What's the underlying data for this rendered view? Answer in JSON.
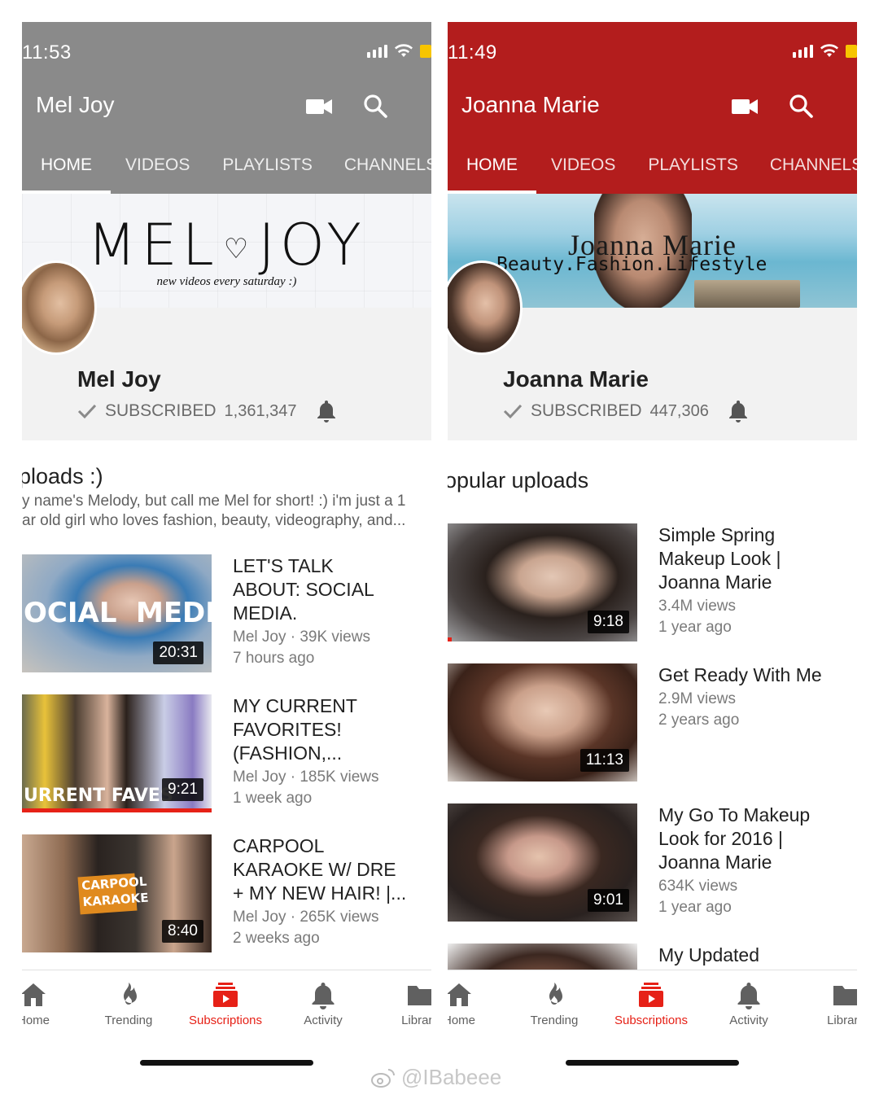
{
  "watermark": {
    "text": "@IBabeee",
    "icon": "weibo-icon"
  },
  "colors": {
    "left_header": "#8a8a8a",
    "right_header": "#b31d1d",
    "accent_red": "#e62117"
  },
  "left": {
    "status": {
      "time": "11:53"
    },
    "channel_title": "Mel Joy",
    "tabs": [
      "HOME",
      "VIDEOS",
      "PLAYLISTS",
      "CHANNELS"
    ],
    "banner": {
      "logo_left": "MEL",
      "logo_right": "JOY",
      "tagline": "new videos every saturday :)"
    },
    "channel": {
      "name": "Mel Joy",
      "subscribed_label": "SUBSCRIBED",
      "subscriber_count": "1,361,347"
    },
    "section_title": "ploads :)",
    "description": [
      "y name's Melody, but call me Mel for short! :) i'm just a 1",
      "ar old girl who loves fashion, beauty, videography, and..."
    ],
    "videos": [
      {
        "title_lines": [
          "LET'S TALK",
          "ABOUT: SOCIAL",
          "MEDIA."
        ],
        "meta1": "Mel Joy · 39K views",
        "meta2": "7 hours ago",
        "duration": "20:31",
        "thumb_text_1": "OCIAL",
        "thumb_text_2": "MEDIA.",
        "progress": 0
      },
      {
        "title_lines": [
          "MY CURRENT",
          "FAVORITES!",
          "(FASHION,..."
        ],
        "meta1": "Mel Joy · 185K views",
        "meta2": "1 week ago",
        "duration": "9:21",
        "thumb_text_1": "URRENT FAVES",
        "progress": 1.0
      },
      {
        "title_lines": [
          "CARPOOL",
          "KARAOKE W/ DRE",
          "+ MY NEW HAIR! |..."
        ],
        "meta1": "Mel Joy · 265K views",
        "meta2": "2 weeks ago",
        "duration": "8:40",
        "thumb_text_1": "CARPOOL",
        "thumb_text_2": "KARAOKE",
        "progress": 0
      }
    ],
    "nav": [
      {
        "label": "Home",
        "icon": "home-icon"
      },
      {
        "label": "Trending",
        "icon": "trending-flame-icon"
      },
      {
        "label": "Subscriptions",
        "icon": "subscriptions-icon",
        "active": true
      },
      {
        "label": "Activity",
        "icon": "bell-icon"
      },
      {
        "label": "Library",
        "icon": "folder-icon"
      }
    ]
  },
  "right": {
    "status": {
      "time": "11:49"
    },
    "channel_title": "Joanna Marie",
    "tabs": [
      "HOME",
      "VIDEOS",
      "PLAYLISTS",
      "CHANNELS"
    ],
    "banner": {
      "title": "Joanna Marie",
      "tagline": "Beauty.Fashion.Lifestyle"
    },
    "channel": {
      "name": "Joanna Marie",
      "subscribed_label": "SUBSCRIBED",
      "subscriber_count": "447,306"
    },
    "section_title": "opular uploads",
    "videos": [
      {
        "title_lines": [
          "Simple Spring",
          "Makeup Look |",
          "Joanna Marie"
        ],
        "meta1": "3.4M views",
        "meta2": "1 year ago",
        "duration": "9:18",
        "progress": 0.02
      },
      {
        "title_lines": [
          "Get Ready With Me"
        ],
        "meta1": "2.9M views",
        "meta2": "2 years ago",
        "duration": "11:13",
        "progress": 0
      },
      {
        "title_lines": [
          "My Go To Makeup",
          "Look for 2016 |",
          "Joanna Marie"
        ],
        "meta1": "634K views",
        "meta2": "1 year ago",
        "duration": "9:01",
        "progress": 0
      },
      {
        "title_lines": [
          "My Updated"
        ],
        "meta1": "",
        "meta2": "",
        "duration": "",
        "progress": 0
      }
    ],
    "nav": [
      {
        "label": "Home",
        "icon": "home-icon"
      },
      {
        "label": "Trending",
        "icon": "trending-flame-icon"
      },
      {
        "label": "Subscriptions",
        "icon": "subscriptions-icon",
        "active": true
      },
      {
        "label": "Activity",
        "icon": "bell-icon"
      },
      {
        "label": "Library",
        "icon": "folder-icon"
      }
    ]
  }
}
